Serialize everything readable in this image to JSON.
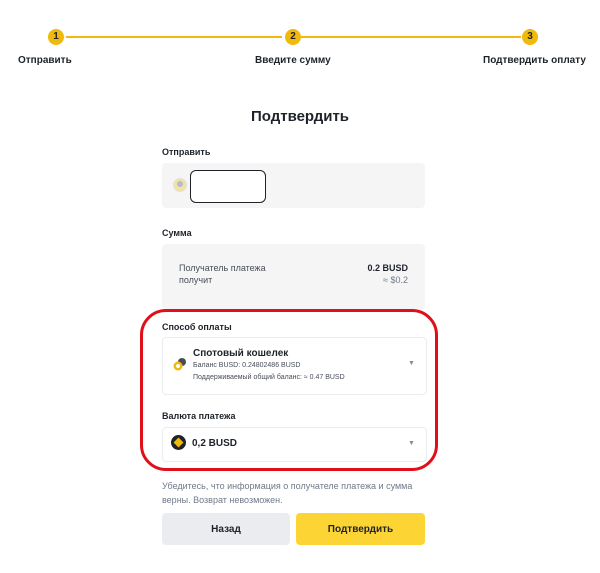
{
  "stepper": {
    "steps": [
      {
        "number": "1",
        "label": "Отправить"
      },
      {
        "number": "2",
        "label": "Введите сумму"
      },
      {
        "number": "3",
        "label": "Подтвердить оплату"
      }
    ]
  },
  "page_title": "Подтвердить",
  "send": {
    "label": "Отправить",
    "field_value": ""
  },
  "amount": {
    "label": "Сумма",
    "recipient_line1": "Получатель платежа",
    "recipient_line2": "получит",
    "value": "0.2 BUSD",
    "approx": "≈ $0.2"
  },
  "payment_method": {
    "label": "Способ оплаты",
    "title": "Спотовый кошелек",
    "balance": "Баланс BUSD: 0.24802486 BUSD",
    "supported_total": "Поддерживаемый общий баланс: ≈ 0.47 BUSD"
  },
  "currency": {
    "label": "Валюта платежа",
    "value": "0,2 BUSD"
  },
  "notice": "Убедитесь, что информация о получателе платежа и сумма верны. Возврат невозможен.",
  "buttons": {
    "back": "Назад",
    "confirm": "Подтвердить"
  },
  "colors": {
    "accent": "#f0b90b",
    "confirm_button": "#fcd535",
    "highlight_outline": "#e0101a"
  },
  "icons": {
    "send_avatar": "user-avatar-icon",
    "wallet": "spot-wallet-icon",
    "currency": "busd-coin-icon",
    "dropdown": "chevron-down-icon"
  }
}
